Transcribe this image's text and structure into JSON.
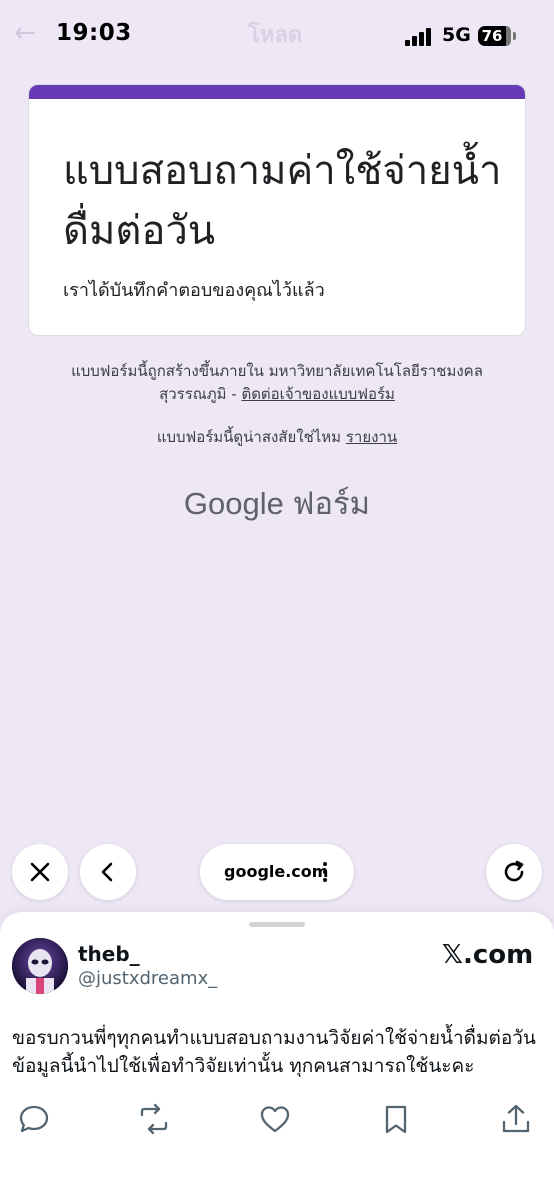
{
  "status_bar": {
    "time": "19:03",
    "network": "5G",
    "battery": "76",
    "ghost_title": "โหลด"
  },
  "form": {
    "title": "แบบสอบถามค่าใช้จ่ายน้ำดื่มต่อวัน",
    "confirmation": "เราได้บันทึกคำตอบของคุณไว้แล้ว",
    "accent_color": "#673ab7",
    "footer_line1": "แบบฟอร์มนี้ถูกสร้างขึ้นภายใน มหาวิทยาลัยเทคโนโลยีราชมงคลสุวรรณภูมิ -",
    "contact_link": "ติดต่อเจ้าของแบบฟอร์ม",
    "suspicious_text": "แบบฟอร์มนี้ดูน่าสงสัยใช่ไหม",
    "report_link": "รายงาน",
    "logo_google": "Google",
    "logo_forms": "ฟอร์ม"
  },
  "browser": {
    "url": "google.com",
    "icons": [
      "close-icon",
      "back-chevron-icon",
      "more-vertical-icon",
      "reload-icon"
    ]
  },
  "post": {
    "display_name": "theb_",
    "handle": "@justxdreamx_",
    "site": "𝕏.com",
    "text": "ขอรบกวนพี่ๆทุกคนทำแบบสอบถามงานวิจัยค่าใช้จ่ายน้ำดื่มต่อวัน ข้อมูลนี้นำไปใช้เพื่อทำวิจัยเท่านั้น ทุกคนสามารถใช้นะคะ",
    "actions": [
      "reply-icon",
      "repost-icon",
      "like-icon",
      "bookmark-icon",
      "share-icon"
    ]
  }
}
